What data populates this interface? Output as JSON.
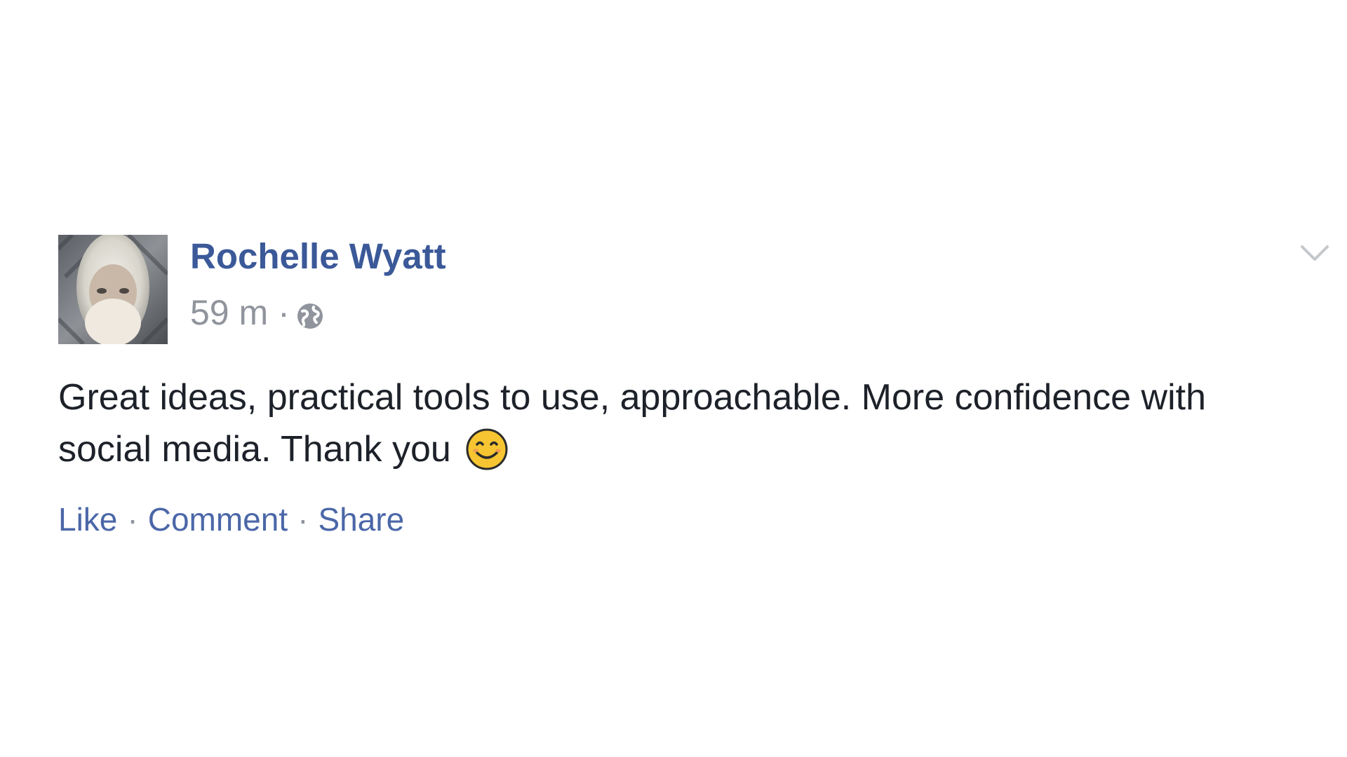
{
  "post": {
    "author": "Rochelle Wyatt",
    "timestamp": "59 m",
    "separator": "·",
    "audience_icon": "globe-icon",
    "menu_icon": "chevron-down-icon",
    "text": "Great ideas, practical tools to use, approachable. More confidence with social media. Thank you",
    "emoji_icon": "smiling-face-emoji",
    "actions": {
      "like": "Like",
      "comment": "Comment",
      "share": "Share",
      "separator": "·"
    }
  },
  "colors": {
    "author": "#3b5998",
    "meta": "#90949c",
    "body": "#1d2129",
    "link": "#4b67a8",
    "emoji": "#f7c531"
  }
}
